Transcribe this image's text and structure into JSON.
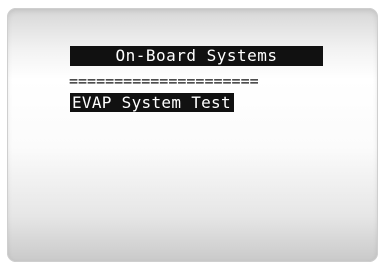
{
  "screen": {
    "title": "On-Board Systems",
    "divider": "=====================",
    "menu_items": [
      {
        "label": "EVAP System Test",
        "selected": true
      }
    ]
  },
  "colors": {
    "highlight_bg": "#111111",
    "highlight_text": "#ffffff",
    "text": "#111111"
  }
}
